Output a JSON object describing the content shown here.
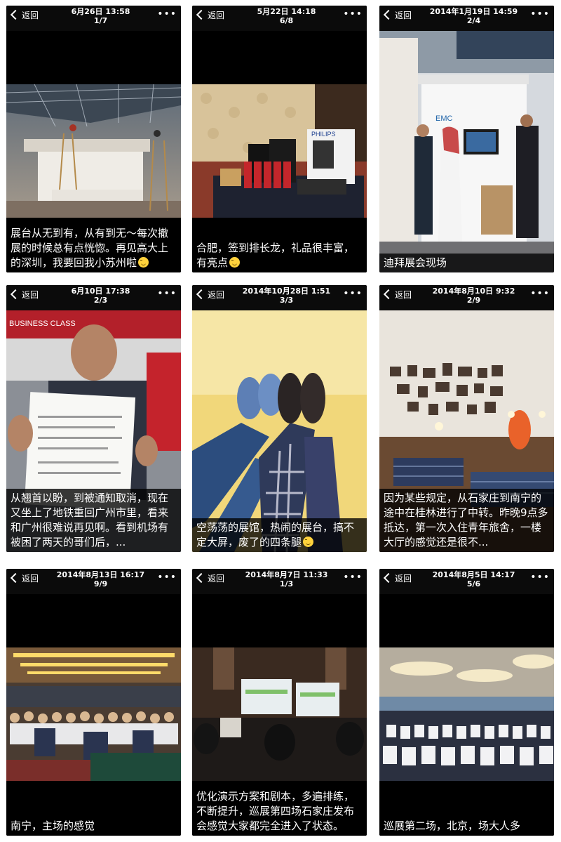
{
  "back_label": "返回",
  "more_icon": "more-dots-icon",
  "back_icon": "chevron-left-icon",
  "cards": [
    {
      "timestamp": "6月26日 13:58",
      "counter": "1/7",
      "caption": "展台从无到有，从有到无～每次撤展的时候总有点恍惚。再见高大上的深圳，我要回我小苏州啦",
      "emoji": true,
      "photo": "exhibition-hall-construction"
    },
    {
      "timestamp": "5月22日 14:18",
      "counter": "6/8",
      "caption": "合肥，签到排长龙，礼品很丰富，有亮点",
      "emoji": true,
      "photo": "luggage-gifts-philips"
    },
    {
      "timestamp": "2014年1月19日 14:59",
      "counter": "2/4",
      "caption": "迪拜展会现场",
      "emoji": false,
      "photo": "dubai-expo-booth"
    },
    {
      "timestamp": "6月10日 17:38",
      "counter": "2/3",
      "caption": "从翘首以盼，到被通知取消，现在又坐上了地铁重回广州市里，看来和广州很难说再见啊。看到机场有被困了两天的哥们后，...",
      "emoji": false,
      "photo": "man-with-flight-delay-certificate"
    },
    {
      "timestamp": "2014年10月28日 1:51",
      "counter": "3/3",
      "caption": "空荡荡的展馆，热闹的展台，搞不定大屏，废了的四条腿",
      "emoji": true,
      "photo": "legs-and-shoes"
    },
    {
      "timestamp": "2014年8月10日 9:32",
      "counter": "2/9",
      "caption": "因为某些规定，从石家庄到南宁的途中在桂林进行了中转。昨晚9点多抵达，第一次入住青年旅舍，一楼大厅的感觉还是很不...",
      "emoji": false,
      "photo": "hostel-lobby"
    },
    {
      "timestamp": "2014年8月13日 16:17",
      "counter": "9/9",
      "caption": "南宁，主场的感觉",
      "emoji": false,
      "photo": "conference-audience"
    },
    {
      "timestamp": "2014年8月7日 11:33",
      "counter": "1/3",
      "caption": "优化演示方案和剧本，多遍排练，不断提升，巡展第四场石家庄发布会感觉大家都完全进入了状态。",
      "emoji": false,
      "photo": "presentation-screens"
    },
    {
      "timestamp": "2014年8月5日 14:17",
      "counter": "5/6",
      "caption": "巡展第二场，北京，场大人多",
      "emoji": false,
      "photo": "banquet-hall-chairs"
    }
  ]
}
